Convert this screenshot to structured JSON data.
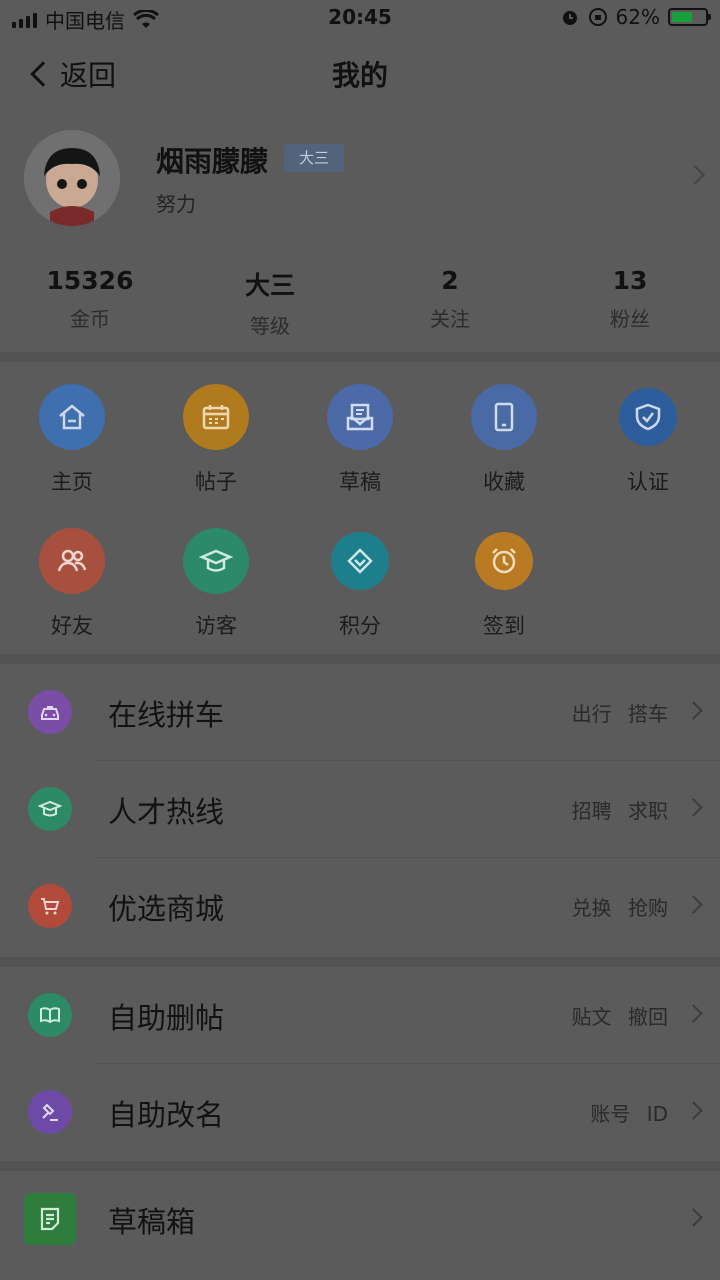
{
  "status_bar": {
    "carrier": "中国电信",
    "time": "20:45",
    "battery": "62%",
    "battery_level": 0.62
  },
  "nav": {
    "back_label": "返回",
    "title": "我的"
  },
  "profile": {
    "name": "烟雨朦朦",
    "badge": "大三",
    "motto": "努力"
  },
  "stats": [
    {
      "value": "15326",
      "label": "金币"
    },
    {
      "value": "大三",
      "label": "等级"
    },
    {
      "value": "2",
      "label": "关注"
    },
    {
      "value": "13",
      "label": "粉丝"
    }
  ],
  "grid": [
    {
      "label": "主页",
      "icon": "home-icon",
      "color": "#3f6fae"
    },
    {
      "label": "帖子",
      "icon": "calendar-icon",
      "color": "#b07a1f"
    },
    {
      "label": "草稿",
      "icon": "draft-icon",
      "color": "#4d6aa8"
    },
    {
      "label": "收藏",
      "icon": "phone-icon",
      "color": "#4a6aa6"
    },
    {
      "label": "认证",
      "icon": "shield-icon",
      "color": "#2e5d9e"
    },
    {
      "label": "好友",
      "icon": "friends-icon",
      "color": "#a8503f"
    },
    {
      "label": "访客",
      "icon": "graduation-cap-icon",
      "color": "#2c8a6a"
    },
    {
      "label": "积分",
      "icon": "diamond-icon",
      "color": "#1e7f8c"
    },
    {
      "label": "签到",
      "icon": "alarm-clock-icon",
      "color": "#b87a22"
    }
  ],
  "section1": [
    {
      "title": "在线拼车",
      "tags": "出行 搭车",
      "icon": "car-icon",
      "color": "#7a4ea6"
    },
    {
      "title": "人才热线",
      "tags": "招聘 求职",
      "icon": "graduation-cap-icon",
      "color": "#2d8a66"
    },
    {
      "title": "优选商城",
      "tags": "兑换 抢购",
      "icon": "cart-icon",
      "color": "#b24a3c"
    }
  ],
  "section2": [
    {
      "title": "自助删帖",
      "tags": "贴文 撤回",
      "icon": "book-icon",
      "color": "#2d8a66"
    },
    {
      "title": "自助改名",
      "tags": "账号 ID",
      "icon": "hammer-icon",
      "color": "#6e4aa8"
    }
  ],
  "section3": [
    {
      "title": "草稿箱",
      "icon": "note-icon",
      "color": "#2e7d3c"
    }
  ]
}
